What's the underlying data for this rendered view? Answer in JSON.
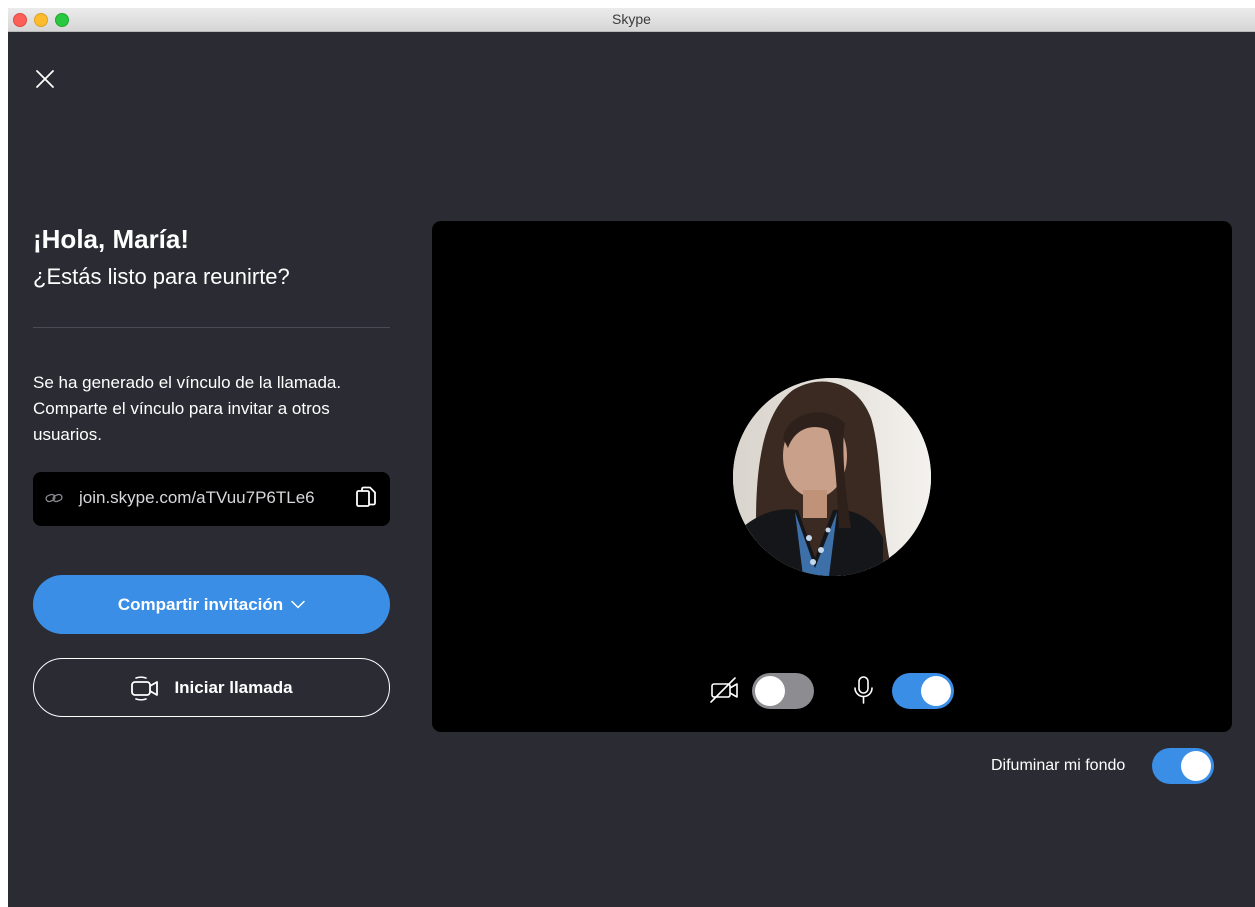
{
  "window": {
    "title": "Skype"
  },
  "greeting": {
    "title": "¡Hola, María!",
    "subtitle": "¿Estás listo para reunirte?"
  },
  "info": {
    "line1": "Se ha generado el vínculo de la llamada.",
    "line2": "Comparte el vínculo para invitar a otros",
    "line3": "usuarios."
  },
  "link": {
    "url": "join.skype.com/aTVuu7P6TLe6",
    "icon": "link-icon",
    "copy_icon": "copy-icon"
  },
  "buttons": {
    "share_label": "Compartir invitación",
    "start_call_label": "Iniciar llamada"
  },
  "video_controls": {
    "camera_enabled": false,
    "microphone_enabled": true
  },
  "background_blur": {
    "label": "Difuminar mi fondo",
    "enabled": true
  },
  "colors": {
    "background": "#2a2b33",
    "accent": "#3b8ee5",
    "video_panel": "#000000"
  }
}
